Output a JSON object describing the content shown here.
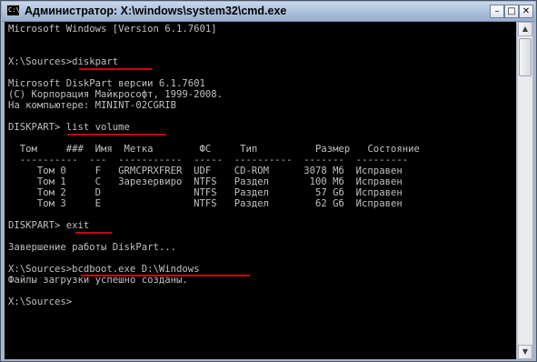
{
  "window": {
    "title": "Администратор: X:\\windows\\system32\\cmd.exe",
    "icon_text": "C:\\",
    "buttons": {
      "minimize": "–",
      "maximize": "□",
      "close": "✕"
    }
  },
  "console": {
    "lines": [
      "Microsoft Windows [Version 6.1.7601]",
      "",
      "",
      "X:\\Sources>diskpart",
      "",
      "Microsoft DiskPart версии 6.1.7601",
      "(C) Корпорация Майкрософт, 1999-2008.",
      "На компьютере: MININT-02CGRIB",
      "",
      "DISKPART> list volume",
      "",
      "  Том     ###  Имя  Метка        ФС     Тип          Размер   Состояние",
      "  ----------  ---  -----------  -----  ----------  -------  ---------",
      "     Том 0     F   GRMCPRXFRER  UDF    CD-ROM      3078 Мб  Исправен",
      "     Том 1     C   Зарезервиро  NTFS   Раздел       100 Мб  Исправен",
      "     Том 2     D                NTFS   Раздел        57 Gб  Исправен",
      "     Том 3     E                NTFS   Раздел        62 Gб  Исправен",
      "",
      "DISKPART> exit",
      "",
      "Завершение работы DiskPart...",
      "",
      "X:\\Sources>bcdboot.exe D:\\Windows",
      "Файлы загрузки успешно созданы.",
      "",
      "X:\\Sources>"
    ]
  },
  "scrollbar": {
    "up_arrow": "▲",
    "down_arrow": "▼"
  }
}
